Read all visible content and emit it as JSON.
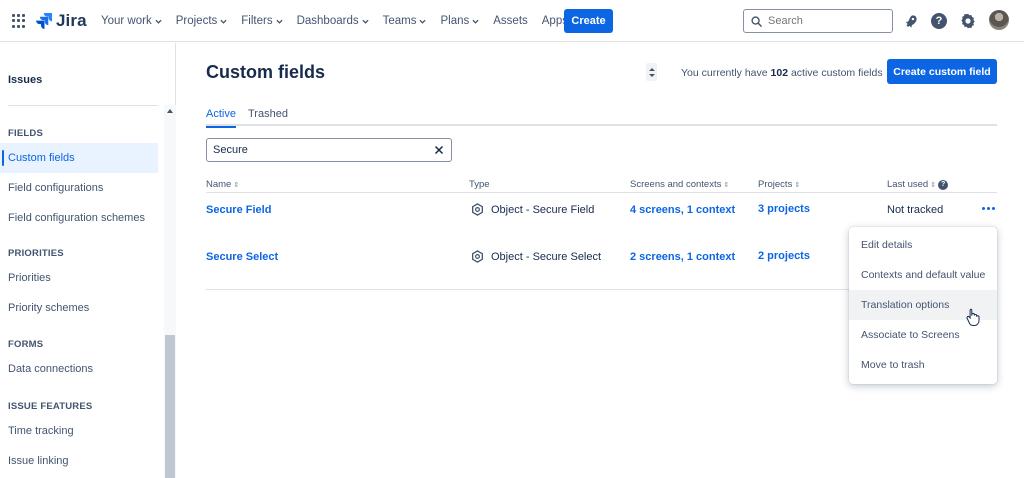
{
  "topnav": {
    "logo_text": "Jira",
    "items": [
      {
        "label": "Your work",
        "has_menu": true
      },
      {
        "label": "Projects",
        "has_menu": true
      },
      {
        "label": "Filters",
        "has_menu": true
      },
      {
        "label": "Dashboards",
        "has_menu": true
      },
      {
        "label": "Teams",
        "has_menu": true
      },
      {
        "label": "Plans",
        "has_menu": true
      },
      {
        "label": "Assets",
        "has_menu": false
      },
      {
        "label": "Apps",
        "has_menu": true
      }
    ],
    "create_label": "Create",
    "search_placeholder": "Search",
    "help_glyph": "?"
  },
  "sidebar": {
    "title": "Issues",
    "sections": [
      {
        "label": "FIELDS",
        "items": [
          {
            "label": "Custom fields",
            "active": true
          },
          {
            "label": "Field configurations",
            "active": false
          },
          {
            "label": "Field configuration schemes",
            "active": false
          }
        ]
      },
      {
        "label": "PRIORITIES",
        "items": [
          {
            "label": "Priorities",
            "active": false
          },
          {
            "label": "Priority schemes",
            "active": false
          }
        ]
      },
      {
        "label": "FORMS",
        "items": [
          {
            "label": "Data connections",
            "active": false
          }
        ]
      },
      {
        "label": "ISSUE FEATURES",
        "items": [
          {
            "label": "Time tracking",
            "active": false
          },
          {
            "label": "Issue linking",
            "active": false
          }
        ]
      }
    ]
  },
  "main": {
    "title": "Custom fields",
    "count_prefix": "You currently have",
    "count_value": "102",
    "count_suffix": "active custom fields",
    "create_button": "Create custom field",
    "tabs": [
      {
        "label": "Active",
        "active": true
      },
      {
        "label": "Trashed",
        "active": false
      }
    ],
    "filter_value": "Secure",
    "columns": {
      "name": "Name",
      "type": "Type",
      "screens": "Screens and contexts",
      "projects": "Projects",
      "last_used": "Last used"
    },
    "sort_glyph": "⇕",
    "info_glyph": "?",
    "rows": [
      {
        "name": "Secure Field",
        "type": "Object - Secure Field",
        "screens": "4 screens, 1 context",
        "projects": "3 projects",
        "last_used": "Not tracked"
      },
      {
        "name": "Secure Select",
        "type": "Object - Secure Select",
        "screens": "2 screens, 1 context",
        "projects": "2 projects",
        "last_used": ""
      }
    ]
  },
  "menu": {
    "items": [
      {
        "label": "Edit details",
        "hover": false
      },
      {
        "label": "Contexts and default value",
        "hover": false
      },
      {
        "label": "Translation options",
        "hover": true
      },
      {
        "label": "Associate to Screens",
        "hover": false
      },
      {
        "label": "Move to trash",
        "hover": false
      }
    ]
  },
  "colors": {
    "brand_blue": "#0c66e4",
    "text": "#172b4d",
    "subtle_text": "#44546f",
    "border": "#dfe1e6",
    "selected_bg": "#e9f2ff"
  },
  "icons": {
    "app_switcher": "grid-icon",
    "logo": "jira-logo-icon",
    "search": "search-icon",
    "notifications": "rocket-icon",
    "help": "help-icon",
    "settings": "gear-icon",
    "field_type": "hexagon-object-icon",
    "more": "more-horizontal-icon",
    "clear": "close-icon"
  }
}
